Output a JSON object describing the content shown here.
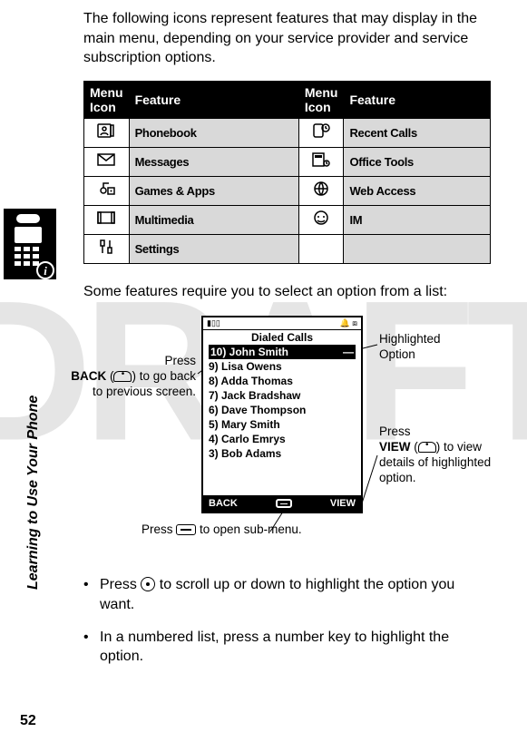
{
  "watermark": "DRAFT",
  "intro": "The following icons represent features that may display in the main menu, depending on your service provider and service subscription options.",
  "table_headers": {
    "icon1": "Menu Icon",
    "feat1": "Feature",
    "icon2": "Menu Icon",
    "feat2": "Feature"
  },
  "menu_rows": [
    {
      "icon1": "phonebook-icon",
      "feat1": "Phonebook",
      "icon2": "recent-calls-icon",
      "feat2": "Recent Calls"
    },
    {
      "icon1": "messages-icon",
      "feat1": "Messages",
      "icon2": "office-tools-icon",
      "feat2": "Office Tools"
    },
    {
      "icon1": "games-icon",
      "feat1": "Games & Apps",
      "icon2": "web-access-icon",
      "feat2": "Web Access"
    },
    {
      "icon1": "multimedia-icon",
      "feat1": "Multimedia",
      "icon2": "im-icon",
      "feat2": "IM"
    },
    {
      "icon1": "settings-icon",
      "feat1": "Settings",
      "icon2": "",
      "feat2": ""
    }
  ],
  "mid_text": "Some features require you to select an option from a list:",
  "screen": {
    "title": "Dialed Calls",
    "items": [
      "10) John Smith",
      "9) Lisa Owens",
      "8) Adda Thomas",
      "7) Jack Bradshaw",
      "6) Dave Thompson",
      "5) Mary Smith",
      "4) Carlo Emrys",
      "3) Bob Adams"
    ],
    "soft_left": "BACK",
    "soft_right": "VIEW"
  },
  "callouts": {
    "left_1": "Press",
    "left_2": "BACK",
    "left_3": " (",
    "left_4": ") to go back to previous screen.",
    "hi_1": "Highlighted",
    "hi_2": "Option",
    "view_1": "Press",
    "view_2": "VIEW",
    "view_3": " (",
    "view_4": ") to view details of highlighted option.",
    "bottom_1": "Press ",
    "bottom_2": " to open sub-menu."
  },
  "bullets": [
    {
      "pre": "Press ",
      "post": " to scroll up or down to highlight the option you want.",
      "key": "nav"
    },
    {
      "pre": "In a numbered list, press a number key to highlight the option.",
      "post": "",
      "key": "none"
    }
  ],
  "side_tab": "Learning to Use Your Phone",
  "page_number": "52"
}
